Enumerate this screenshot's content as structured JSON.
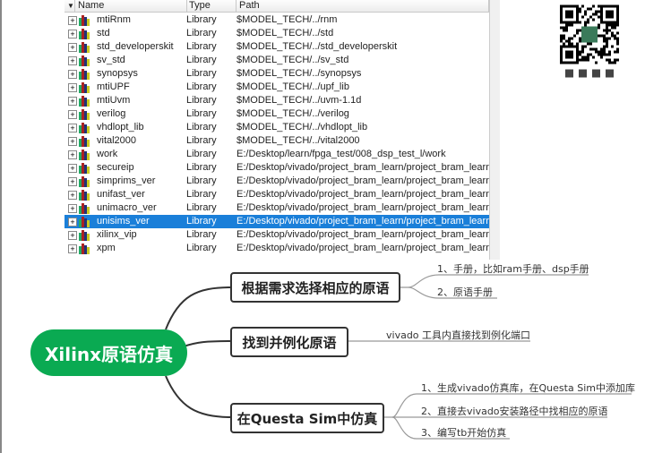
{
  "library": {
    "columns": [
      "Name",
      "Type",
      "Path"
    ],
    "rows": [
      {
        "name": "mtiRnm",
        "type": "Library",
        "path": "$MODEL_TECH/../rnm"
      },
      {
        "name": "std",
        "type": "Library",
        "path": "$MODEL_TECH/../std"
      },
      {
        "name": "std_developerskit",
        "type": "Library",
        "path": "$MODEL_TECH/../std_developerskit"
      },
      {
        "name": "sv_std",
        "type": "Library",
        "path": "$MODEL_TECH/../sv_std"
      },
      {
        "name": "synopsys",
        "type": "Library",
        "path": "$MODEL_TECH/../synopsys"
      },
      {
        "name": "mtiUPF",
        "type": "Library",
        "path": "$MODEL_TECH/../upf_lib"
      },
      {
        "name": "mtiUvm",
        "type": "Library",
        "path": "$MODEL_TECH/../uvm-1.1d"
      },
      {
        "name": "verilog",
        "type": "Library",
        "path": "$MODEL_TECH/../verilog"
      },
      {
        "name": "vhdlopt_lib",
        "type": "Library",
        "path": "$MODEL_TECH/../vhdlopt_lib"
      },
      {
        "name": "vital2000",
        "type": "Library",
        "path": "$MODEL_TECH/../vital2000"
      },
      {
        "name": "work",
        "type": "Library",
        "path": "E:/Desktop/learn/fpga_test/008_dsp_test_l/work"
      },
      {
        "name": "secureip",
        "type": "Library",
        "path": "E:/Desktop/vivado/project_bram_learn/project_bram_learn.ca"
      },
      {
        "name": "simprims_ver",
        "type": "Library",
        "path": "E:/Desktop/vivado/project_bram_learn/project_bram_learn.ca"
      },
      {
        "name": "unifast_ver",
        "type": "Library",
        "path": "E:/Desktop/vivado/project_bram_learn/project_bram_learn.ca"
      },
      {
        "name": "unimacro_ver",
        "type": "Library",
        "path": "E:/Desktop/vivado/project_bram_learn/project_bram_learn.ca"
      },
      {
        "name": "unisims_ver",
        "type": "Library",
        "path": "E:/Desktop/vivado/project_bram_learn/project_bram_learn.ca",
        "selected": true
      },
      {
        "name": "xilinx_vip",
        "type": "Library",
        "path": "E:/Desktop/vivado/project_bram_learn/project_bram_learn.ca"
      },
      {
        "name": "xpm",
        "type": "Library",
        "path": "E:/Desktop/vivado/project_bram_learn/project_bram_learn.ca"
      }
    ]
  },
  "mindmap": {
    "root": "Xilinx原语仿真",
    "branches": [
      {
        "label": "根据需求选择相应的原语",
        "children": [
          "1、手册，比如ram手册、dsp手册",
          "2、原语手册"
        ]
      },
      {
        "label": "找到并例化原语",
        "children": [
          "vivado 工具内直接找到例化端口"
        ]
      },
      {
        "label": "在Questa Sim中仿真",
        "children": [
          "1、生成vivado仿真库，在Questa Sim中添加库",
          "2、直接去vivado安装路径中找相应的原语",
          "3、编写tb开始仿真"
        ]
      }
    ],
    "accent": "#0aaa52"
  }
}
